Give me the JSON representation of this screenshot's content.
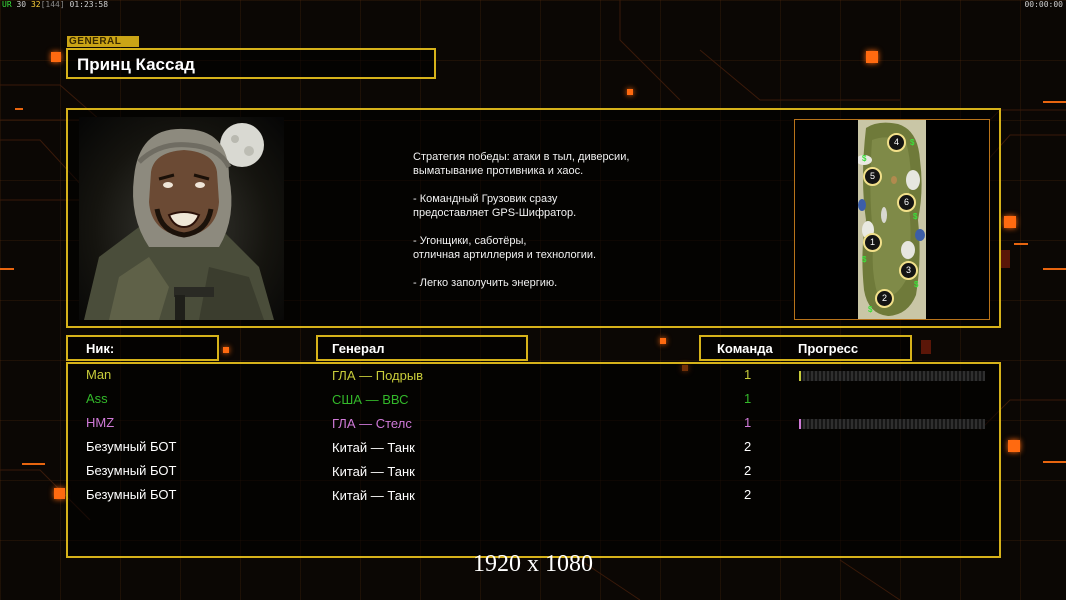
{
  "hud": {
    "ur": "UR",
    "fps_a": "30",
    "fps_b": "32",
    "ping": "[144]",
    "clock": "01:23:58",
    "timer": "00:00:00"
  },
  "general": {
    "tag": "GENERAL",
    "name": "Принц Кассад",
    "description": "Стратегия победы: атаки в тыл, диверсии,\n выматывание противника и хаос.\n\n- Командный Грузовик сразу\nпредоставляет GPS-Шифратор.\n\n- Угонщики, саботёры,\nотличная артиллерия и технологии.\n\n- Легко заполучить энергию."
  },
  "minimap": {
    "slots": [
      "4",
      "5",
      "6",
      "1",
      "3",
      "2"
    ]
  },
  "table": {
    "headers": {
      "nick": "Ник:",
      "general": "Генерал",
      "team": "Команда",
      "progress": "Прогресс"
    },
    "rows": [
      {
        "nick": "Man",
        "general": "ГЛА — Подрыв",
        "team": "1",
        "color": "#c8cc3a",
        "progress": 0.01,
        "show_progress": true
      },
      {
        "nick": "Ass",
        "general": "США — ВВС",
        "team": "1",
        "color": "#33b82a",
        "progress": 0.0,
        "show_progress": false
      },
      {
        "nick": "HMZ",
        "general": "ГЛА — Стелс",
        "team": "1",
        "color": "#d07ad8",
        "progress": 0.01,
        "show_progress": true
      },
      {
        "nick": "Безумный БОТ",
        "general": "Китай — Танк",
        "team": "2",
        "color": "#ffffff",
        "progress": 0.0,
        "show_progress": false
      },
      {
        "nick": "Безумный БОТ",
        "general": "Китай — Танк",
        "team": "2",
        "color": "#ffffff",
        "progress": 0.0,
        "show_progress": false
      },
      {
        "nick": "Безумный БОТ",
        "general": "Китай — Танк",
        "team": "2",
        "color": "#ffffff",
        "progress": 0.0,
        "show_progress": false
      }
    ]
  },
  "resolution": "1920 x 1080",
  "colors": {
    "frame": "#d6b21a",
    "accent_orange": "#ff6a10"
  }
}
